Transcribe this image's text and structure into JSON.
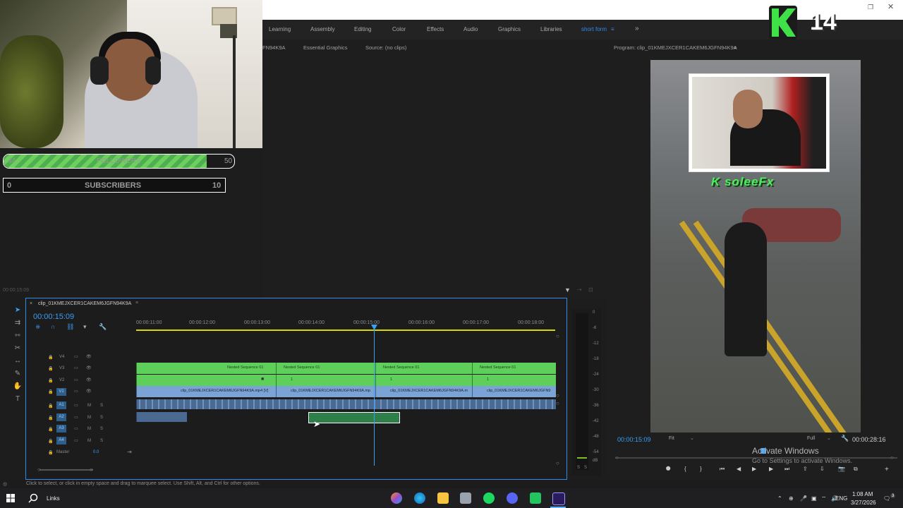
{
  "workspace_tabs": [
    "Learning",
    "Assembly",
    "Editing",
    "Color",
    "Effects",
    "Audio",
    "Graphics",
    "Libraries",
    "short form"
  ],
  "source_panel": {
    "tab_clip": "FN94K9A",
    "tab_essential": "Essential Graphics",
    "tab_source": "Source: (no clips)",
    "timecode": "00:00:15:09"
  },
  "program": {
    "title": "Program: clip_01KMEJXCER1CAKEM6JGFN94K9A",
    "timecode_current": "00:00:15:09",
    "fit_label": "Fit",
    "full_label": "Full",
    "timecode_total": "00:00:28:16"
  },
  "overlay": {
    "followers_current": "44",
    "followers_label": "FOLLOWERS",
    "followers_goal": "50",
    "followers_progress": 0.88,
    "subscribers_current": "0",
    "subscribers_label": "SUBSCRIBERS",
    "subscribers_goal": "10",
    "nametag": "K soleeFx",
    "badge_number": "14"
  },
  "timeline": {
    "sequence_name": "clip_01KMEJXCER1CAKEM6JGFN94K9A",
    "timecode": "00:00:15:09",
    "ruler": [
      "00:00:11:00",
      "00:00:12:00",
      "00:00:13:00",
      "00:00:14:00",
      "00:00:15:00",
      "00:00:16:00",
      "00:00:17:00",
      "00:00:18:00"
    ],
    "video_tracks": [
      "V4",
      "V3",
      "V2",
      "V1"
    ],
    "audio_tracks": [
      "A1",
      "A2",
      "A3",
      "A4"
    ],
    "master_label": "Master",
    "master_value": "0.0",
    "nested_clips": [
      "Nested Sequence 01",
      "Nested Sequence 01",
      "Nested Sequence 01",
      "Nested Sequence 01"
    ],
    "v2_labels": [
      "1",
      "1",
      "1"
    ],
    "v1_clips": [
      "clip_01KMEJXCER1CAKEM6JGFN94K9A.mp4 [V]",
      "clip_01KMEJXCER1CAKEM6JGFN94K9A.mp",
      "clip_01KMEJXCER1CAKEM6JGFN94K9A.m",
      "clip_01KMEJXCER1CAKEM6JGFN9"
    ]
  },
  "meter_labels": [
    "0",
    "-6",
    "-12",
    "-18",
    "-24",
    "-30",
    "-36",
    "-42",
    "-48",
    "-54",
    "dB"
  ],
  "meter_solo": "S",
  "status_text": "Click to select, or click in empty space and drag to marquee select. Use Shift, Alt, and Ctrl for other options.",
  "windows_activate": {
    "title": "Activate Windows",
    "subtitle": "Go to Settings to activate Windows."
  },
  "taskbar": {
    "search_label": "Links",
    "language": "ENG",
    "time": "1:08 AM",
    "date": "3/27/2026",
    "notification_count": "3"
  },
  "colors": {
    "accent_blue": "#2d8ceb",
    "clip_green": "#5fcf5b",
    "clip_blue": "#7ba3d6",
    "playhead": "#3a9ef5",
    "nametag_green": "#4cf05a"
  }
}
